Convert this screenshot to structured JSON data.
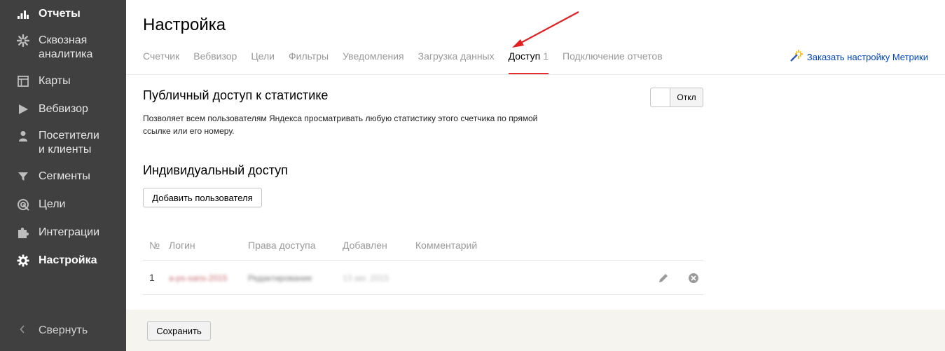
{
  "sidebar": {
    "items": [
      {
        "icon": "bar-chart-icon",
        "label": "Отчеты",
        "active": true
      },
      {
        "icon": "asterisk-icon",
        "label": "Сквозная\nаналитика"
      },
      {
        "icon": "map-icon",
        "label": "Карты"
      },
      {
        "icon": "play-icon",
        "label": "Вебвизор"
      },
      {
        "icon": "person-icon",
        "label": "Посетители\nи клиенты"
      },
      {
        "icon": "funnel-icon",
        "label": "Сегменты"
      },
      {
        "icon": "target-icon",
        "label": "Цели"
      },
      {
        "icon": "puzzle-icon",
        "label": "Интеграции"
      },
      {
        "icon": "gear-icon",
        "label": "Настройка",
        "active": true
      }
    ],
    "collapse_label": "Свернуть"
  },
  "header": {
    "title": "Настройка",
    "tabs": [
      {
        "label": "Счетчик"
      },
      {
        "label": "Вебвизор"
      },
      {
        "label": "Цели"
      },
      {
        "label": "Фильтры"
      },
      {
        "label": "Уведомления"
      },
      {
        "label": "Загрузка данных"
      },
      {
        "label": "Доступ",
        "count": "1",
        "active": true
      },
      {
        "label": "Подключение отчетов"
      }
    ],
    "order_link": "Заказать настройку Метрики"
  },
  "public_access": {
    "title": "Публичный доступ к статистике",
    "description": "Позволяет всем пользователям Яндекса просматривать любую статистику этого счетчика по прямой ссылке или его номеру.",
    "toggle_state": "Откл"
  },
  "individual_access": {
    "title": "Индивидуальный доступ",
    "add_button": "Добавить пользователя",
    "columns": [
      "№",
      "Логин",
      "Права доступа",
      "Добавлен",
      "Комментарий"
    ],
    "rows": [
      {
        "num": "1",
        "login": "a-ps-sans-2015",
        "rights": "Редактирование",
        "added": "13 авг. 2015",
        "comment": ""
      }
    ]
  },
  "footer": {
    "save_button": "Сохранить"
  },
  "colors": {
    "sidebar_bg": "#404040",
    "active_tab_underline": "#e62e2e",
    "link": "#0044bb",
    "footer_bg": "#f5f4ef",
    "annotation_arrow": "#e02020"
  }
}
